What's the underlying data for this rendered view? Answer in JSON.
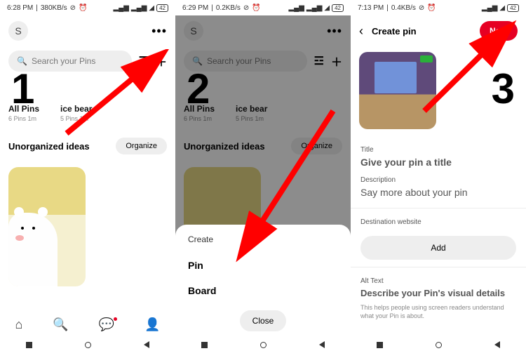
{
  "status": {
    "p1_time": "6:28 PM",
    "p1_net": "380KB/s",
    "p2_time": "6:29 PM",
    "p2_net": "0.2KB/s",
    "p3_time": "7:13 PM",
    "p3_net": "0.4KB/s",
    "battery": "42"
  },
  "profile": {
    "avatar_initial": "S",
    "search_placeholder": "Search your Pins"
  },
  "pins": {
    "all_title": "All Pins",
    "all_sub": "6 Pins  1m",
    "ice_title": "ice bear",
    "ice_sub": "5 Pins  1m",
    "unorganized": "Unorganized ideas",
    "organize": "Organize"
  },
  "sheet": {
    "heading": "Create",
    "option_pin": "Pin",
    "option_board": "Board",
    "close": "Close"
  },
  "create": {
    "header": "Create pin",
    "next": "Next",
    "title_label": "Title",
    "title_value": "Give your pin a title",
    "desc_label": "Description",
    "desc_value": "Say more about your pin",
    "dest_label": "Destination website",
    "add": "Add",
    "alt_label": "Alt Text",
    "alt_value": "Describe your Pin's visual details",
    "alt_helper": "This helps people using screen readers understand what your Pin is about."
  },
  "steps": {
    "s1": "1",
    "s2": "2",
    "s3": "3"
  }
}
